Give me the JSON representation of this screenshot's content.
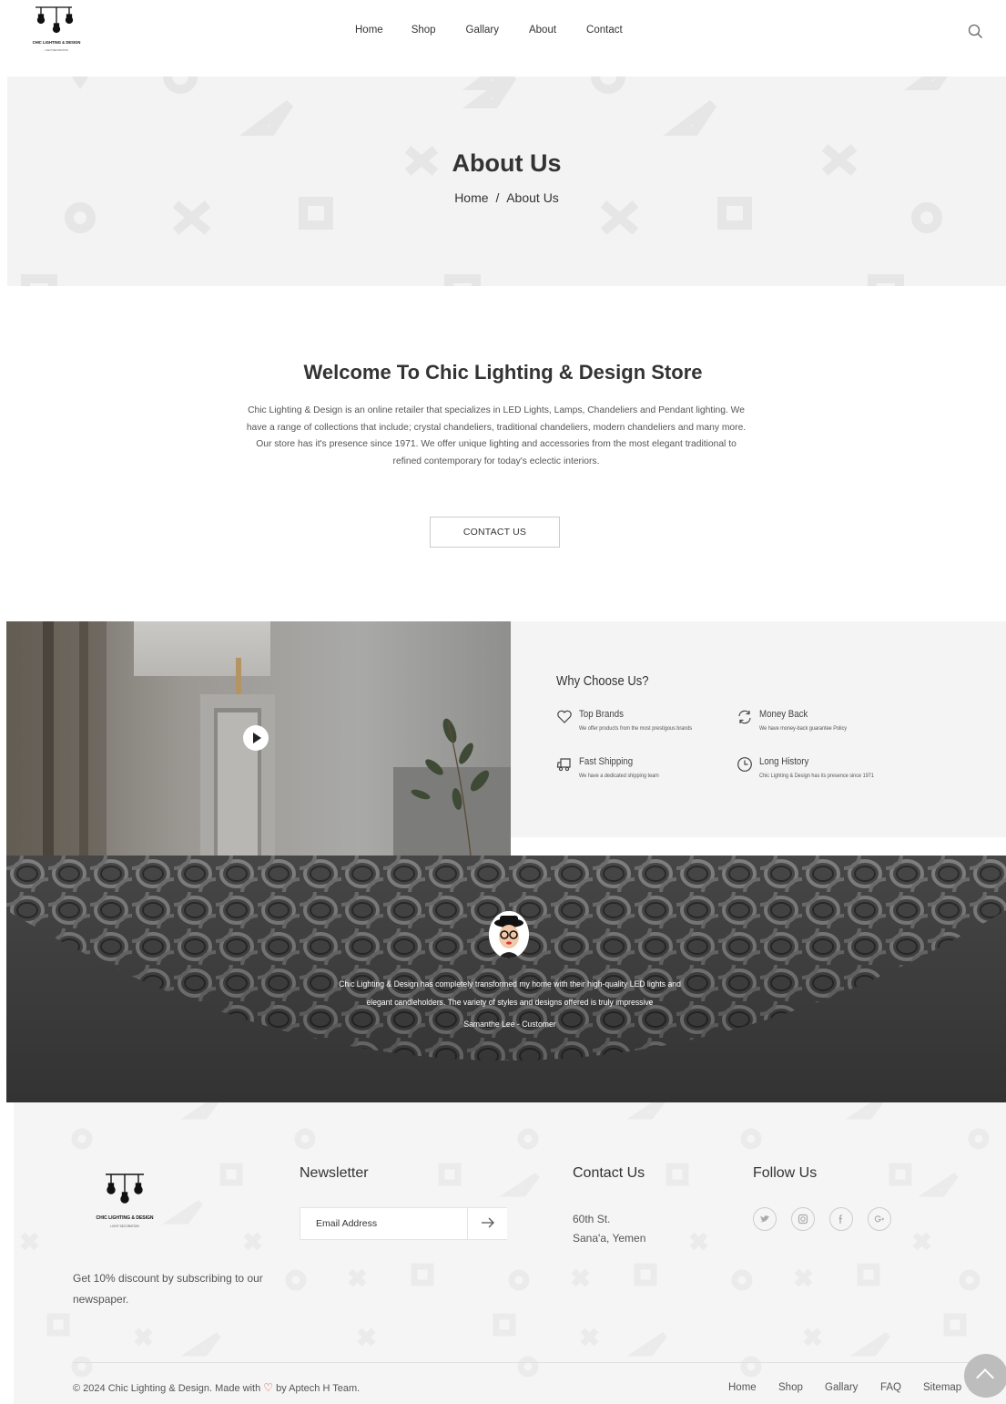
{
  "brand": {
    "name": "CHIC LIGHTING & DESIGN",
    "sub": "LIGHT DECORATION"
  },
  "nav": {
    "items": [
      "Home",
      "Shop",
      "Gallary",
      "About",
      "Contact"
    ],
    "search_icon": "search-icon"
  },
  "hero": {
    "title": "About Us",
    "crumb_home": "Home",
    "crumb_sep": "/",
    "crumb_current": "About Us"
  },
  "welcome": {
    "title": "Welcome To Chic Lighting & Design Store",
    "text": "Chic Lighting & Design is an online retailer that specializes in LED Lights, Lamps, Chandeliers and Pendant lighting. We have a range of collections that include; crystal chandeliers, traditional chandeliers, modern chandeliers and many more. Our store has it's presence since 1971. We offer unique lighting and accessories from the most elegant traditional to refined contemporary for today's eclectic interiors.",
    "button": "CONTACT US"
  },
  "why": {
    "title": "Why Choose Us?",
    "features": [
      {
        "title": "Top Brands",
        "desc": "We offer products from the most prestigous brands",
        "icon": "heart-icon"
      },
      {
        "title": "Money Back",
        "desc": "We have money-back guarantee Policy",
        "icon": "refresh-icon"
      },
      {
        "title": "Fast Shipping",
        "desc": "We have a dedicated shipping team",
        "icon": "truck-icon"
      },
      {
        "title": "Long History",
        "desc": "Chic Lighting & Design has its presence since 1971",
        "icon": "clock-icon"
      }
    ]
  },
  "testimonial": {
    "quote": "Chic Lighting & Design has completely transformed my home with their high-quality LED lights and elegant candleholders. The variety of styles and designs offered is truly impressive",
    "author": "Samanthe Lee - Customer"
  },
  "footer": {
    "promo": "Get 10% discount by subscribing to our newspaper.",
    "newsletter_title": "Newsletter",
    "email_placeholder": "Email Address",
    "contact_title": "Contact Us",
    "address_line1": "60th St.",
    "address_line2": "Sana'a, Yemen",
    "follow_title": "Follow Us",
    "social": [
      "twitter-icon",
      "instagram-icon",
      "facebook-icon",
      "google-plus-icon"
    ],
    "copyright_pre": "© 2024 Chic Lighting & Design. Made with",
    "copyright_heart": "♡",
    "copyright_post": "by Aptech H Team.",
    "links": [
      "Home",
      "Shop",
      "Gallary",
      "FAQ",
      "Sitemap"
    ]
  },
  "colors": {
    "accent_heart": "#e54444",
    "hero_bg": "#f3f3f3",
    "footer_bg": "#f5f5f5"
  }
}
